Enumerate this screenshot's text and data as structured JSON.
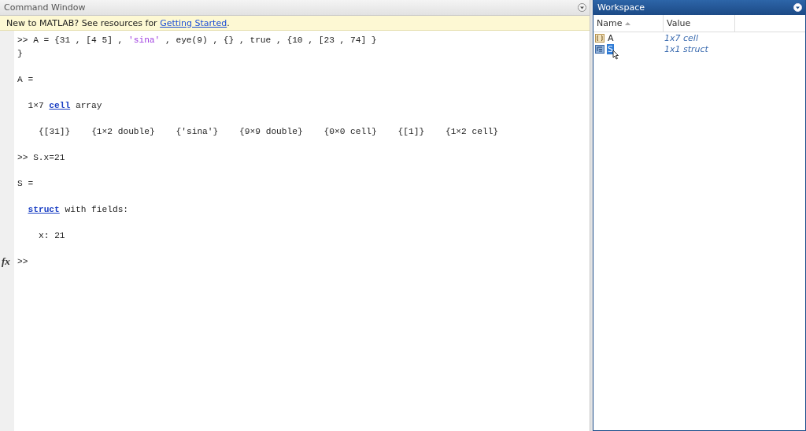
{
  "command_window": {
    "title": "Command Window",
    "info_bar": {
      "text": "New to MATLAB? See resources for ",
      "link": "Getting Started",
      "end": "."
    },
    "lines": [
      {
        "kind": "command",
        "blank_before": false,
        "segments": [
          {
            "kind": "plain",
            "text": ">> A = {31 , [4 5] , "
          },
          {
            "kind": "string",
            "text": "'sina'"
          },
          {
            "kind": "plain",
            "text": " , eye(9) , {} , true , {10 , [23 , 74] }"
          }
        ]
      },
      {
        "kind": "command",
        "blank_before": false,
        "segments": [
          {
            "kind": "plain",
            "text": "}"
          }
        ]
      },
      {
        "kind": "result",
        "blank_before": true,
        "segments": [
          {
            "kind": "plain",
            "text": "A ="
          }
        ]
      },
      {
        "kind": "summary",
        "blank_before": true,
        "segments": [
          {
            "kind": "plain",
            "text": "1×7 "
          },
          {
            "kind": "keyword",
            "text": "cell"
          },
          {
            "kind": "plain",
            "text": " array"
          }
        ]
      },
      {
        "kind": "detail",
        "blank_before": true,
        "segments": [
          {
            "kind": "plain",
            "text": "{[31]}    {1×2 double}    {'sina'}    {9×9 double}    {0×0 cell}    {[1]}    {1×2 cell}"
          }
        ]
      },
      {
        "kind": "command",
        "blank_before": true,
        "segments": [
          {
            "kind": "plain",
            "text": ">> S.x=21"
          }
        ]
      },
      {
        "kind": "result",
        "blank_before": true,
        "segments": [
          {
            "kind": "plain",
            "text": "S ="
          }
        ]
      },
      {
        "kind": "summary",
        "blank_before": true,
        "segments": [
          {
            "kind": "keyword",
            "text": "struct"
          },
          {
            "kind": "plain",
            "text": " with fields:"
          }
        ]
      },
      {
        "kind": "detail",
        "blank_before": true,
        "segments": [
          {
            "kind": "plain",
            "text": "x: 21"
          }
        ]
      }
    ],
    "prompt": {
      "fx": "fx",
      "text": ">>"
    }
  },
  "workspace": {
    "title": "Workspace",
    "columns": [
      "Name",
      "Value"
    ],
    "rows": [
      {
        "kind": "cell",
        "name": "A",
        "value": "1x7 cell",
        "selected": false
      },
      {
        "kind": "struct",
        "name": "S",
        "value": "1x1 struct",
        "selected": true
      }
    ]
  }
}
